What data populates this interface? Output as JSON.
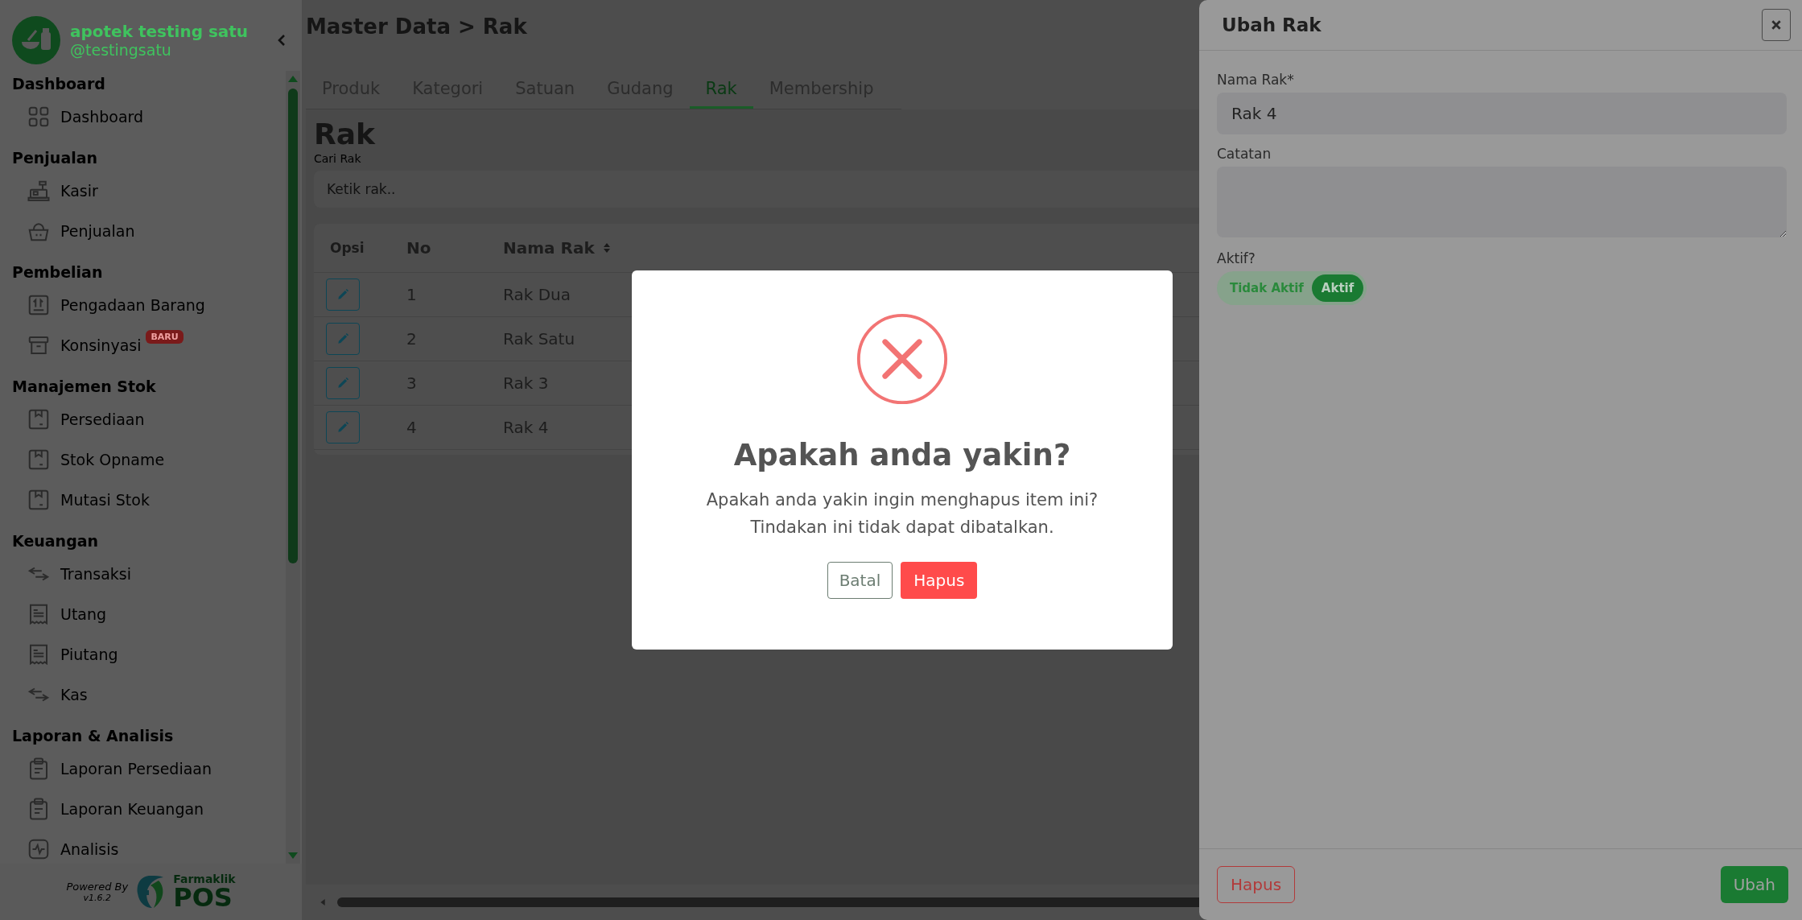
{
  "sidebar": {
    "brand": {
      "name": "apotek testing satu",
      "handle": "@testingsatu"
    },
    "sections": [
      {
        "heading": "Dashboard",
        "items": [
          {
            "label": "Dashboard",
            "selected": false
          }
        ]
      },
      {
        "heading": "Penjualan",
        "items": [
          {
            "label": "Kasir",
            "selected": false
          },
          {
            "label": "Penjualan",
            "selected": false
          }
        ]
      },
      {
        "heading": "Pembelian",
        "items": [
          {
            "label": "Pengadaan Barang",
            "selected": false
          },
          {
            "label": "Konsinyasi",
            "badge": "BARU",
            "selected": false
          }
        ]
      },
      {
        "heading": "Manajemen Stok",
        "items": [
          {
            "label": "Persediaan",
            "selected": false
          },
          {
            "label": "Stok Opname",
            "selected": false
          },
          {
            "label": "Mutasi Stok",
            "selected": false
          }
        ]
      },
      {
        "heading": "Keuangan",
        "items": [
          {
            "label": "Transaksi",
            "selected": false
          },
          {
            "label": "Utang",
            "selected": false
          },
          {
            "label": "Piutang",
            "selected": false
          },
          {
            "label": "Kas",
            "selected": false
          }
        ]
      },
      {
        "heading": "Laporan & Analisis",
        "items": [
          {
            "label": "Laporan Persediaan",
            "selected": false
          },
          {
            "label": "Laporan Keuangan",
            "selected": false
          },
          {
            "label": "Analisis",
            "selected": false
          }
        ]
      }
    ],
    "footer": {
      "powered_by": "Powered By",
      "version": "v1.6.2",
      "logo_top": "Farmaklik",
      "logo_bottom": "POS"
    }
  },
  "page": {
    "breadcrumb": "Master Data > Rak",
    "tabs": [
      {
        "label": "Produk",
        "selected": false
      },
      {
        "label": "Kategori",
        "selected": false
      },
      {
        "label": "Satuan",
        "selected": false
      },
      {
        "label": "Gudang",
        "selected": false
      },
      {
        "label": "Rak",
        "selected": true
      },
      {
        "label": "Membership",
        "selected": false
      }
    ],
    "heading": "Rak",
    "search": {
      "label": "Cari Rak",
      "placeholder": "Ketik rak.."
    },
    "table": {
      "columns": [
        {
          "label": "Opsi",
          "sortable": false
        },
        {
          "label": "No",
          "sortable": false
        },
        {
          "label": "Nama Rak",
          "sortable": true
        }
      ],
      "rows": [
        {
          "no": "1",
          "name": "Rak Dua"
        },
        {
          "no": "2",
          "name": "Rak Satu"
        },
        {
          "no": "3",
          "name": "Rak 3"
        },
        {
          "no": "4",
          "name": "Rak 4"
        }
      ]
    }
  },
  "drawer": {
    "title": "Ubah Rak",
    "name_field": {
      "label": "Nama Rak*",
      "value": "Rak 4"
    },
    "notes_field": {
      "label": "Catatan"
    },
    "active": {
      "label": "Aktif?",
      "options": [
        {
          "label": "Tidak Aktif",
          "selected": false
        },
        {
          "label": "Aktif",
          "selected": true
        }
      ]
    },
    "delete_button": "Hapus",
    "submit_button": "Ubah"
  },
  "dialog": {
    "title": "Apakah anda yakin?",
    "message": [
      "Apakah anda yakin ingin menghapus item ini?",
      "Tindakan ini tidak dapat dibatalkan."
    ],
    "cancel_button": "Batal",
    "confirm_button": "Hapus"
  }
}
